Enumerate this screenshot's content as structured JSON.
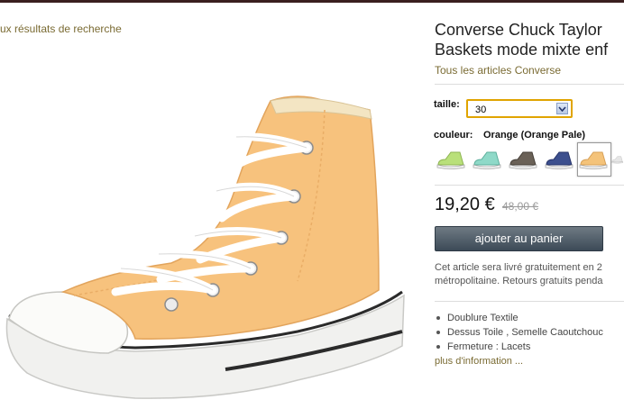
{
  "nav": {
    "back_link": "ux résultats de recherche"
  },
  "product": {
    "title_line1": "Converse Chuck Taylor",
    "title_line2": "Baskets mode mixte enf",
    "brand_link": "Tous les articles Converse",
    "image_icon": "orange-high-top-sneaker-image"
  },
  "size": {
    "label": "taille:",
    "value": "30",
    "icon": "chevron-down-icon"
  },
  "color": {
    "label": "couleur:",
    "value": "Orange (Orange Pale)",
    "swatches": [
      {
        "name": "lime",
        "color": "#b9e07a"
      },
      {
        "name": "mint",
        "color": "#8fd9c8"
      },
      {
        "name": "charcoal",
        "color": "#6a6157"
      },
      {
        "name": "navy",
        "color": "#3c4f8e"
      },
      {
        "name": "orange",
        "color": "#f4c37a",
        "selected": true
      },
      {
        "name": "white",
        "color": "#e6e6e6"
      }
    ]
  },
  "price": {
    "current": "19,20 €",
    "old": "48,00 €"
  },
  "cart": {
    "button_label": "ajouter au panier"
  },
  "delivery": {
    "line1": "Cet article sera livré gratuitement en 2",
    "line2": "métropolitaine. Retours gratuits penda"
  },
  "features": {
    "items": [
      "Doublure Textile",
      "Dessus Toile , Semelle Caoutchouc",
      "Fermeture : Lacets"
    ],
    "more_link": "plus d'information ..."
  },
  "colors": {
    "link": "#7a6b33",
    "accent_border": "#e0a400",
    "button": "#4b5661"
  }
}
